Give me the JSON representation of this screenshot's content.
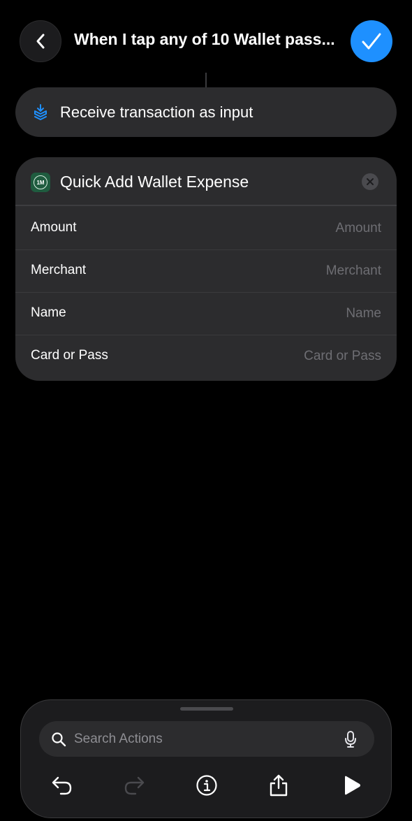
{
  "header": {
    "title": "When I tap any of 10 Wallet pass...",
    "back_icon": "chevron-left-icon",
    "done_icon": "checkmark-icon"
  },
  "trigger": {
    "label": "Receive transaction as input",
    "icon": "wallet-stack-icon"
  },
  "action": {
    "title": "Quick Add Wallet Expense",
    "app_icon": "1M",
    "params": [
      {
        "label": "Amount",
        "placeholder": "Amount"
      },
      {
        "label": "Merchant",
        "placeholder": "Merchant"
      },
      {
        "label": "Name",
        "placeholder": "Name"
      },
      {
        "label": "Card or Pass",
        "placeholder": "Card or Pass"
      }
    ]
  },
  "search": {
    "placeholder": "Search Actions"
  },
  "toolbar": {
    "undo_icon": "undo-icon",
    "redo_icon": "redo-icon",
    "info_icon": "info-icon",
    "share_icon": "share-icon",
    "play_icon": "play-icon"
  },
  "colors": {
    "accent": "#1e90ff",
    "card": "#2c2c2e",
    "background": "#000000",
    "app_icon_bg": "#1f5c3f"
  }
}
